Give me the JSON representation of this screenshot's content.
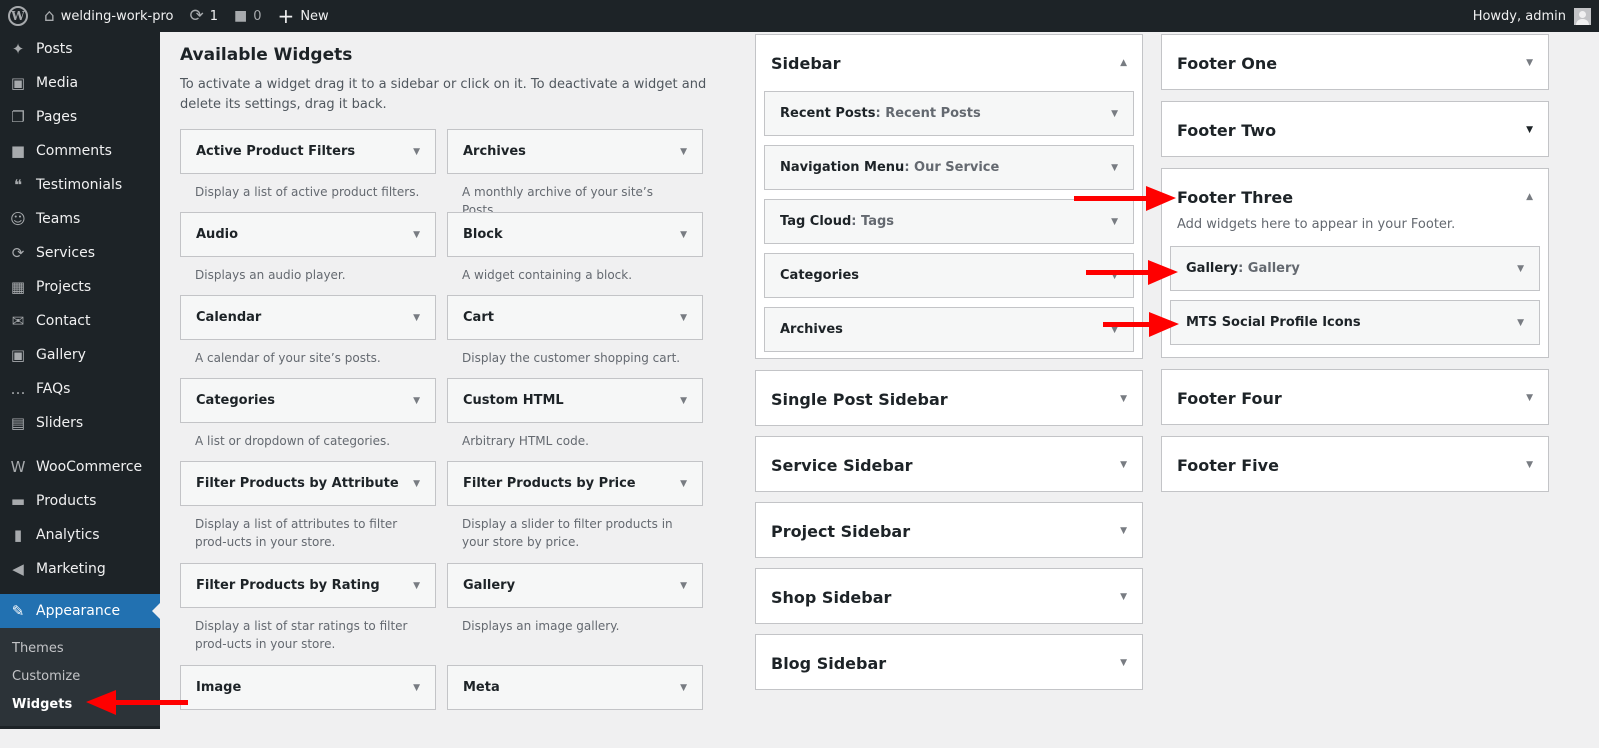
{
  "adminbar": {
    "site_name": "welding-work-pro",
    "updates_count": "1",
    "comments_count": "0",
    "new_label": "New",
    "greeting": "Howdy, admin"
  },
  "menu": {
    "items": [
      {
        "label": "Posts",
        "icon": "pin-icon"
      },
      {
        "label": "Media",
        "icon": "media-icon"
      },
      {
        "label": "Pages",
        "icon": "pages-icon"
      },
      {
        "label": "Comments",
        "icon": "comment-icon"
      },
      {
        "label": "Testimonials",
        "icon": "testimonials-icon"
      },
      {
        "label": "Teams",
        "icon": "groups-icon"
      },
      {
        "label": "Services",
        "icon": "update-icon"
      },
      {
        "label": "Projects",
        "icon": "portfolio-icon"
      },
      {
        "label": "Contact",
        "icon": "email-icon"
      },
      {
        "label": "Gallery",
        "icon": "gallery-icon"
      },
      {
        "label": "FAQs",
        "icon": "format-chat-icon"
      },
      {
        "label": "Sliders",
        "icon": "images-icon"
      }
    ],
    "items2": [
      {
        "label": "WooCommerce",
        "icon": "woo-icon"
      },
      {
        "label": "Products",
        "icon": "archive-icon"
      },
      {
        "label": "Analytics",
        "icon": "chart-bar-icon"
      },
      {
        "label": "Marketing",
        "icon": "megaphone-icon"
      }
    ],
    "current": {
      "label": "Appearance",
      "icon": "paintbrush-icon"
    },
    "submenu": [
      "Themes",
      "Customize",
      "Widgets"
    ]
  },
  "available": {
    "title": "Available Widgets",
    "description": "To activate a widget drag it to a sidebar or click on it. To deactivate a widget and delete its settings, drag it back.",
    "widgets": [
      {
        "name": "Active Product Filters",
        "desc": "Display a list of active product filters."
      },
      {
        "name": "Archives",
        "desc": "A monthly archive of your site’s Posts."
      },
      {
        "name": "Audio",
        "desc": "Displays an audio player."
      },
      {
        "name": "Block",
        "desc": "A widget containing a block."
      },
      {
        "name": "Calendar",
        "desc": "A calendar of your site’s posts."
      },
      {
        "name": "Cart",
        "desc": "Display the customer shopping cart."
      },
      {
        "name": "Categories",
        "desc": "A list or dropdown of categories."
      },
      {
        "name": "Custom HTML",
        "desc": "Arbitrary HTML code."
      },
      {
        "name": "Filter Products by Attribute",
        "desc": "Display a list of attributes to filter prod-ucts in your store."
      },
      {
        "name": "Filter Products by Price",
        "desc": "Display a slider to filter products in your store by price."
      },
      {
        "name": "Filter Products by Rating",
        "desc": "Display a list of star ratings to filter prod-ucts in your store."
      },
      {
        "name": "Gallery",
        "desc": "Displays an image gallery."
      },
      {
        "name": "Image",
        "desc": ""
      },
      {
        "name": "Meta",
        "desc": ""
      }
    ]
  },
  "sidebars": {
    "sidebar": {
      "title": "Sidebar",
      "widgets": [
        {
          "name": "Recent Posts",
          "title": "Recent Posts"
        },
        {
          "name": "Navigation Menu",
          "title": "Our Service"
        },
        {
          "name": "Tag Cloud",
          "title": "Tags"
        },
        {
          "name": "Categories",
          "title": ""
        },
        {
          "name": "Archives",
          "title": ""
        }
      ]
    },
    "collapsed_col1": [
      "Single Post Sidebar",
      "Service Sidebar",
      "Project Sidebar",
      "Shop Sidebar",
      "Blog Sidebar"
    ],
    "footer_one": "Footer One",
    "footer_two": "Footer Two",
    "footer_three": {
      "title": "Footer Three",
      "description": "Add widgets here to appear in your Footer.",
      "widgets": [
        {
          "name": "Gallery",
          "title": "Gallery"
        },
        {
          "name": "MTS Social Profile Icons",
          "title": ""
        }
      ]
    },
    "footer_four": "Footer Four",
    "footer_five": "Footer Five"
  },
  "colors": {
    "adminbar_bg": "#1d2327",
    "accent": "#2271b1",
    "annotation_arrow": "#ff0000"
  }
}
